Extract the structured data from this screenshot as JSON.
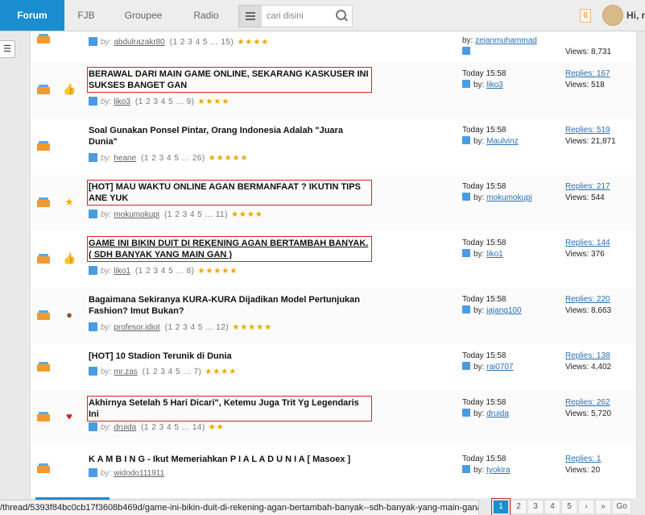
{
  "nav": {
    "tabs": [
      {
        "label": "Forum"
      },
      {
        "label": "FJB"
      },
      {
        "label": "Groupee"
      },
      {
        "label": "Radio"
      }
    ],
    "search_placeholder": "cari disini",
    "notification_count": "6",
    "greeting": "Hi, n"
  },
  "threads": [
    {
      "title": "",
      "author": "abdulrazakr80",
      "pages": "1  2  3  4  5 ... 15",
      "stars": "★★★★",
      "last_time": "",
      "last_by_label": "by:",
      "last_user": "zeianmuhammad",
      "replies": "",
      "views": "Views: 8,731"
    },
    {
      "title": "BERAWAL DARI MAIN GAME ONLINE, SEKARANG KASKUSER INI SUKSES BANGET GAN",
      "author": "liko3",
      "pages": "1  2  3  4  5 ... 9",
      "stars": "★★★★",
      "last_time": "Today 15:58",
      "last_by_label": "by:",
      "last_user": "liko3",
      "replies": "Replies: 167",
      "views": "Views: 518"
    },
    {
      "title": "Soal Gunakan Ponsel Pintar, Orang Indonesia Adalah \"Juara Dunia\"",
      "author": "heane",
      "pages": "1  2  3  4  5 ... 26",
      "stars": "★★★★★",
      "last_time": "Today 15:58",
      "last_by_label": "by:",
      "last_user": "Maulvinz",
      "replies": "Replies: 519",
      "views": "Views: 21,871"
    },
    {
      "title": "[HOT] MAU WAKTU ONLINE AGAN BERMANFAAT ? IKUTIN TIPS ANE YUK",
      "author": "mokumokupi",
      "pages": "1  2  3  4  5 ... 11",
      "stars": "★★★★",
      "last_time": "Today 15:58",
      "last_by_label": "by:",
      "last_user": "mokumokupi",
      "replies": "Replies: 217",
      "views": "Views: 544"
    },
    {
      "title": "GAME INI BIKIN DUIT DI REKENING AGAN BERTAMBAH BANYAK. ( SDH BANYAK YANG MAIN GAN )",
      "author": "liko1",
      "pages": "1  2  3  4  5 ... 8",
      "stars": "★★★★★",
      "last_time": "Today 15:58",
      "last_by_label": "by:",
      "last_user": "liko1",
      "replies": "Replies: 144",
      "views": "Views: 376"
    },
    {
      "title": "Bagaimana Sekiranya KURA-KURA Dijadikan Model Pertunjukan Fashion? Imut Bukan?",
      "author": "profesor.idiot",
      "pages": "1  2  3  4  5 ... 12",
      "stars": "★★★★★",
      "last_time": "Today 15:58",
      "last_by_label": "by:",
      "last_user": "jajang100",
      "replies": "Replies: 220",
      "views": "Views: 8,663"
    },
    {
      "title": "[HOT] 10 Stadion Terunik di Dunia",
      "author": "mr.zas",
      "pages": "1  2  3  4  5 ... 7",
      "stars": "★★★★",
      "last_time": "Today 15:58",
      "last_by_label": "by:",
      "last_user": "rai0707",
      "replies": "Replies: 138",
      "views": "Views: 4,402"
    },
    {
      "title": "Akhirnya Setelah 5 Hari Dicari\", Ketemu Juga Trit Yg Legendaris Ini",
      "author": "druida",
      "pages": "1  2  3  4  5 ... 14",
      "stars": "★★",
      "last_time": "Today 15:58",
      "last_by_label": "by:",
      "last_user": "druida",
      "replies": "Replies: 262",
      "views": "Views: 5,720"
    },
    {
      "title": "K A M B I N G - Ikut Memeriahkan P I A L A D U N I A [ Masoex ]",
      "author": "widodo111911",
      "pages": "",
      "stars": "",
      "last_time": "Today 15:58",
      "last_by_label": "by:",
      "last_user": "tyokira",
      "replies": "Replies: 1",
      "views": "Views: 20"
    }
  ],
  "by_label": "by:",
  "status_url": "/thread/5393f84bc0cb17f3608b469d/game-ini-bikin-duit-di-rekening-agan-bertambah-banyak--sdh-banyak-yang-main-gan/",
  "pagination": {
    "pages": [
      "1",
      "2",
      "3",
      "4",
      "5"
    ],
    "next": "›",
    "last": "»",
    "go": "Go"
  }
}
